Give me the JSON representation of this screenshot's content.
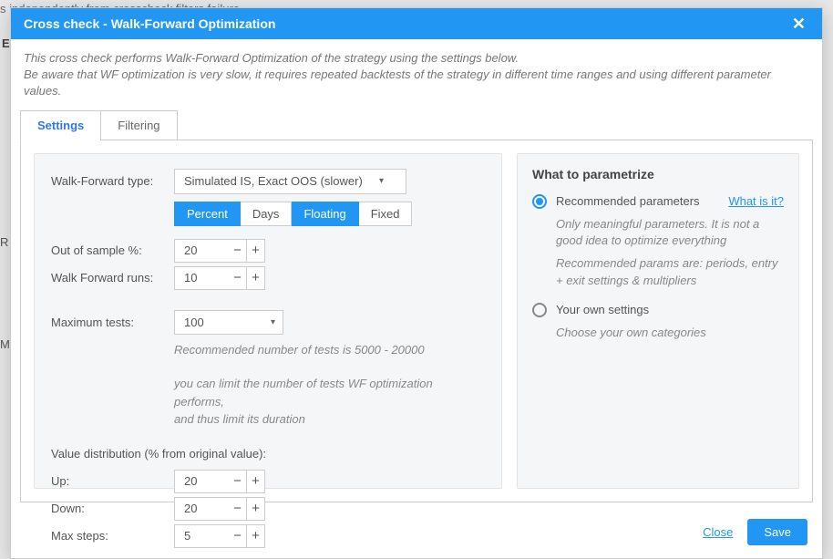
{
  "bg": {
    "line1": "s independently from crosscheck filters failure",
    "e": "E",
    "r": "R",
    "m": "M"
  },
  "header": {
    "title": "Cross check - Walk-Forward Optimization"
  },
  "intro": {
    "line1": "This cross check performs Walk-Forward Optimization of the strategy using the settings below.",
    "line2": "Be aware that WF optimization is very slow, it requires repeated backtests of the strategy in different time ranges and using different parameter values."
  },
  "tabs": {
    "settings": "Settings",
    "filtering": "Filtering"
  },
  "left": {
    "wf_type_label": "Walk-Forward type:",
    "wf_type_value": "Simulated IS, Exact OOS (slower)",
    "seg": {
      "percent": "Percent",
      "days": "Days",
      "floating": "Floating",
      "fixed": "Fixed"
    },
    "oos_pct_label": "Out of sample %:",
    "oos_pct_value": "20",
    "runs_label": "Walk Forward runs:",
    "runs_value": "10",
    "max_tests_label": "Maximum tests:",
    "max_tests_value": "100",
    "rec_tests": "Recommended number of tests is 5000 - 20000",
    "hint2a": "you can limit the number of tests WF optimization performs,",
    "hint2b": "and thus limit its duration",
    "dist_title": "Value distribution (% from original value):",
    "up_label": "Up:",
    "up_value": "20",
    "down_label": "Down:",
    "down_value": "20",
    "max_steps_label": "Max steps:",
    "max_steps_value": "5"
  },
  "right": {
    "title": "What to parametrize",
    "what_link": "What is it?",
    "recommended_label": "Recommended parameters",
    "rec_help1": "Only meaningful parameters. It is not a good idea to optimize everything",
    "rec_help2": "Recommended params are: periods, entry + exit settings & multipliers",
    "own_label": "Your own settings",
    "own_help": "Choose your own categories"
  },
  "footer": {
    "close": "Close",
    "save": "Save"
  }
}
